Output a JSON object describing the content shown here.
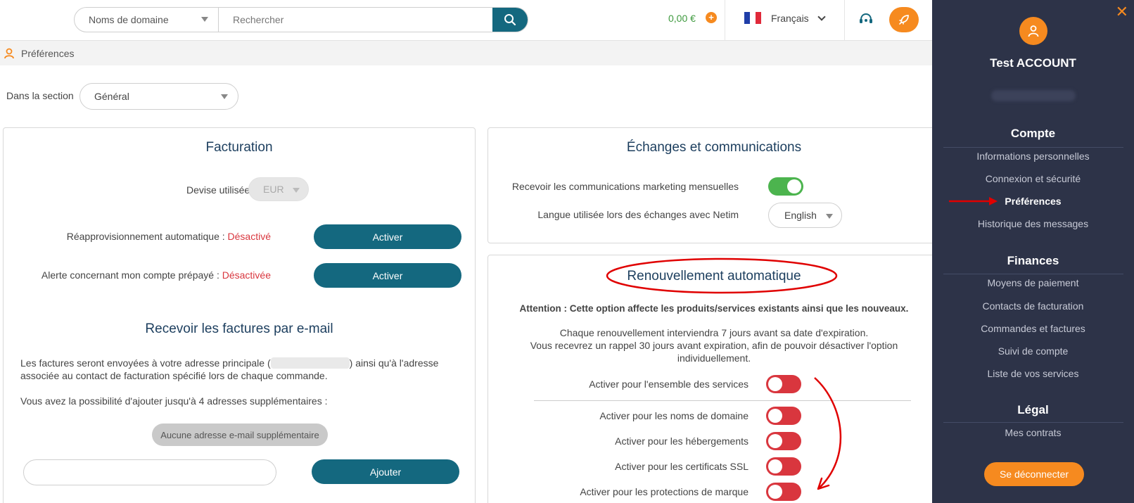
{
  "topbar": {
    "search_type": "Noms de domaine",
    "search_placeholder": "Rechercher",
    "balance": "0,00 €",
    "language": "Français",
    "colors": {
      "accent": "#14687f",
      "brand_orange": "#f68a1f"
    }
  },
  "breadcrumb": {
    "label": "Préférences"
  },
  "section": {
    "label": "Dans la section",
    "value": "Général"
  },
  "billing": {
    "title": "Facturation",
    "currency_label": "Devise utilisée :",
    "currency_value": "EUR",
    "auto_refill_label": "Réapprovisionnement automatique :",
    "auto_refill_status": "Désactivé",
    "auto_refill_button": "Activer",
    "prepaid_alert_label": "Alerte concernant mon compte prépayé :",
    "prepaid_alert_status": "Désactivée",
    "prepaid_alert_button": "Activer",
    "invoices_title": "Recevoir les factures par e-mail",
    "invoices_text_before": "Les factures seront envoyées à votre adresse principale (",
    "invoices_text_after": ") ainsi qu'à l'adresse",
    "invoices_text_line2": "associée au contact de facturation spécifié lors de chaque commande.",
    "extra_text": "Vous avez la possibilité d'ajouter jusqu'à 4 adresses supplémentaires :",
    "no_extra_badge": "Aucune adresse e-mail supplémentaire",
    "email_input_value": "",
    "add_button": "Ajouter"
  },
  "communications": {
    "title": "Échanges et communications",
    "marketing_label": "Recevoir les communications marketing mensuelles",
    "marketing_enabled": true,
    "language_label": "Langue utilisée lors des échanges avec Netim",
    "language_value": "English"
  },
  "renewal": {
    "title": "Renouvellement automatique",
    "warning": "Attention : Cette option affecte les produits/services existants ainsi que les nouveaux.",
    "info_line1": "Chaque renouvellement interviendra 7 jours avant sa date d'expiration.",
    "info_line2": "Vous recevrez un rappel 30 jours avant expiration, afin de pouvoir désactiver l'option",
    "info_line3": "individuellement.",
    "toggles": [
      {
        "label": "Activer pour l'ensemble des services",
        "enabled": false
      },
      {
        "label": "Activer pour les noms de domaine",
        "enabled": false
      },
      {
        "label": "Activer pour les hébergements",
        "enabled": false
      },
      {
        "label": "Activer pour les certificats SSL",
        "enabled": false
      },
      {
        "label": "Activer pour les protections de marque",
        "enabled": false
      }
    ]
  },
  "panel": {
    "account_name": "Test ACCOUNT",
    "sections": [
      {
        "heading": "Compte",
        "items": [
          "Informations personnelles",
          "Connexion et sécurité",
          "Préférences",
          "Historique des messages"
        ]
      },
      {
        "heading": "Finances",
        "items": [
          "Moyens de paiement",
          "Contacts de facturation",
          "Commandes et factures",
          "Suivi de compte",
          "Liste de vos services"
        ]
      },
      {
        "heading": "Légal",
        "items": [
          "Mes contrats"
        ]
      }
    ],
    "active_item": "Préférences",
    "logout_label": "Se déconnecter"
  }
}
